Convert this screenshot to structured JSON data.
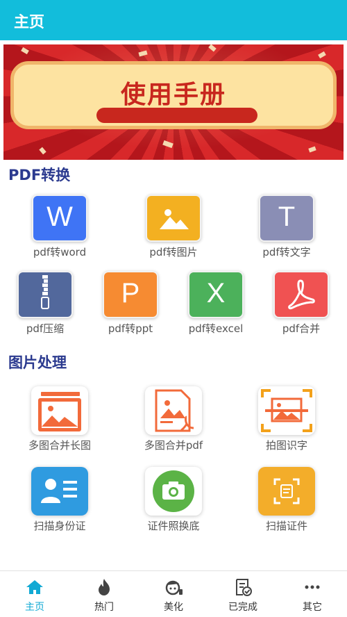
{
  "header": {
    "title": "主页"
  },
  "banner": {
    "title": "使用手册"
  },
  "sections": {
    "pdf": {
      "title": "PDF转换",
      "items": [
        {
          "label": "pdf转word",
          "glyph": "W",
          "color": "#3f74f5",
          "icon": "word-icon"
        },
        {
          "label": "pdf转图片",
          "glyph": "",
          "color": "#f3b021",
          "icon": "image-icon"
        },
        {
          "label": "pdf转文字",
          "glyph": "T",
          "color": "#8a8eb5",
          "icon": "text-icon"
        },
        {
          "label": "pdf压缩",
          "glyph": "",
          "color": "#52689c",
          "icon": "zip-icon"
        },
        {
          "label": "pdf转ppt",
          "glyph": "P",
          "color": "#f68b32",
          "icon": "ppt-icon"
        },
        {
          "label": "pdf转excel",
          "glyph": "X",
          "color": "#4cb15b",
          "icon": "excel-icon"
        },
        {
          "label": "pdf合并",
          "glyph": "",
          "color": "#f05252",
          "icon": "pdf-merge-icon"
        }
      ]
    },
    "image": {
      "title": "图片处理",
      "items": [
        {
          "label": "多图合并长图",
          "icon": "merge-long-image-icon",
          "color": "#f26a3a"
        },
        {
          "label": "多图合并pdf",
          "icon": "merge-pdf-icon",
          "color": "#f26a3a"
        },
        {
          "label": "拍图识字",
          "icon": "scan-text-icon",
          "color": "#f26a3a"
        },
        {
          "label": "扫描身份证",
          "icon": "id-card-icon",
          "color": "#2f9be0"
        },
        {
          "label": "证件照换底",
          "icon": "camera-icon",
          "color": "#5bb346"
        },
        {
          "label": "扫描证件",
          "icon": "scan-document-icon",
          "color": "#f3ad2a"
        }
      ]
    }
  },
  "bottom_nav": [
    {
      "label": "主页",
      "icon": "home-icon",
      "active": true
    },
    {
      "label": "热门",
      "icon": "flame-icon",
      "active": false
    },
    {
      "label": "美化",
      "icon": "beautify-icon",
      "active": false
    },
    {
      "label": "已完成",
      "icon": "completed-icon",
      "active": false
    },
    {
      "label": "其它",
      "icon": "more-icon",
      "active": false
    }
  ],
  "colors": {
    "header": "#12bddb",
    "accent": "#12a9d4",
    "section_title": "#2b3a8f"
  }
}
